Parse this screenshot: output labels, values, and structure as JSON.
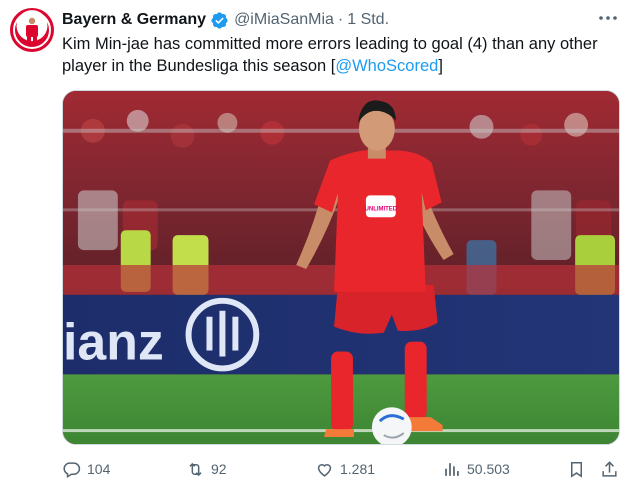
{
  "tweet": {
    "display_name": "Bayern & Germany",
    "handle": "@iMiaSanMia",
    "separator": "·",
    "time": "1 Std.",
    "text_before": "Kim Min-jae has committed more errors leading to goal (4) than any other player in the Bundesliga this season [",
    "mention": "@WhoScored",
    "text_after": "]"
  },
  "media": {
    "board_text": "ianz",
    "shirt_text": "UNLIMITED"
  },
  "actions": {
    "replies": "104",
    "retweets": "92",
    "likes": "1.281",
    "views": "50.503"
  },
  "colors": {
    "accent": "#1d9bf0",
    "muted": "#536471",
    "kit_red": "#e8262b",
    "pitch": "#3f8a36"
  },
  "icons": {
    "verified": "verified-badge-icon",
    "more": "more-dots-icon",
    "reply": "reply-icon",
    "retweet": "retweet-icon",
    "like": "heart-icon",
    "views": "views-chart-icon",
    "bookmark": "bookmark-icon",
    "share": "share-icon"
  }
}
